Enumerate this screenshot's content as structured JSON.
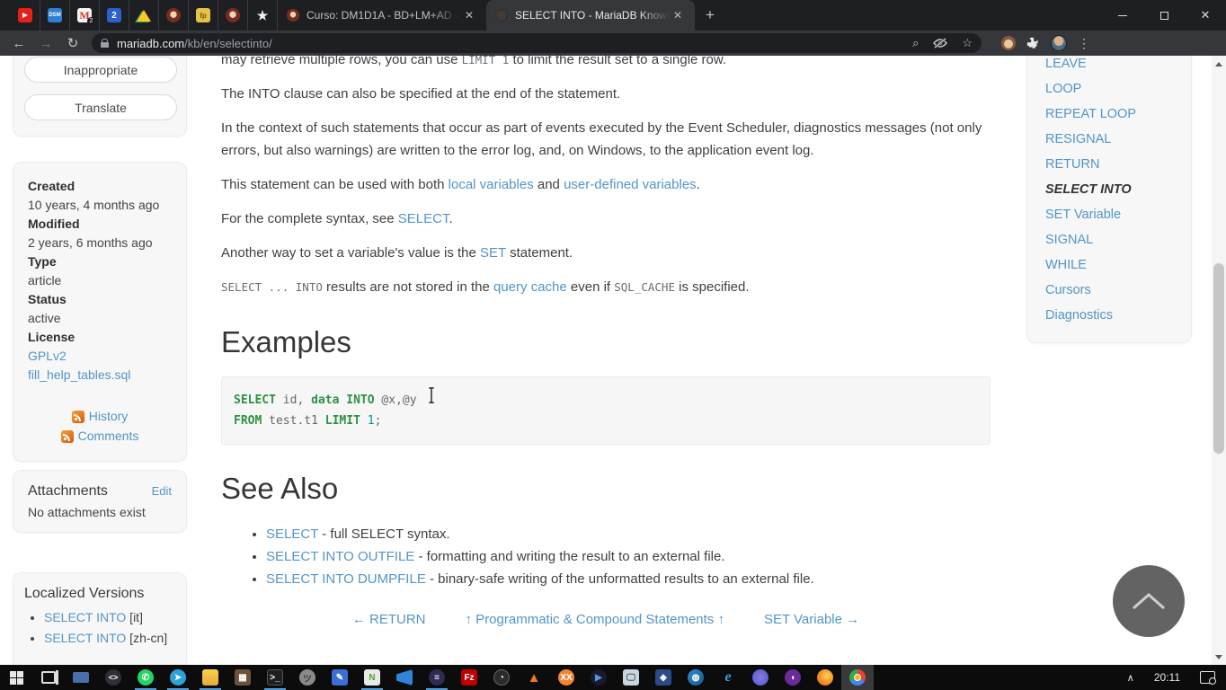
{
  "browser": {
    "pinned_favicons": [
      "youtube",
      "dsm",
      "gmail",
      "calendar-2",
      "google-drive",
      "moodle-crest",
      "fp-gold",
      "moodle-crest",
      "bookmark-star"
    ],
    "gmail_badge": "2",
    "calendar_glyph": "2",
    "dsm_label": "DSM",
    "fp_label": "fp",
    "star_glyph": "★",
    "tabs": [
      {
        "title": "Curso: DM1D1A - BD+LM+AD - ...",
        "close": "✕"
      },
      {
        "title": "SELECT INTO - MariaDB Knowled",
        "close": "✕"
      }
    ],
    "newtab_glyph": "+",
    "window_controls": {
      "close": "✕"
    },
    "nav": {
      "back": "←",
      "forward": "→",
      "reload": "↻"
    },
    "url": {
      "host": "mariadb.com",
      "path": "/kb/en/selectinto/"
    },
    "omnibox_icons": {
      "zoom": "⌕",
      "star": "☆",
      "dots": "⋮"
    }
  },
  "left_sidebar": {
    "flag_buttons": [
      "Inappropriate",
      "Translate"
    ],
    "info": {
      "rows": [
        {
          "label": "Created",
          "value": "10 years, 4 months ago"
        },
        {
          "label": "Modified",
          "value": "2 years, 6 months ago"
        },
        {
          "label": "Type",
          "value": "article"
        },
        {
          "label": "Status",
          "value": "active"
        },
        {
          "label": "License",
          "value": ""
        }
      ],
      "license_links": [
        "GPLv2",
        "fill_help_tables.sql"
      ],
      "feed_links": [
        "History",
        "Comments"
      ]
    },
    "attachments": {
      "title": "Attachments",
      "edit": "Edit",
      "body": "No attachments exist"
    },
    "localized": {
      "title": "Localized Versions",
      "items": [
        {
          "link": "SELECT INTO",
          "suffix": " [it]"
        },
        {
          "link": "SELECT INTO",
          "suffix": " [zh-cn]"
        }
      ]
    }
  },
  "content": {
    "p1": {
      "a": "may retrieve multiple rows, you can use ",
      "code": "LIMIT 1",
      "b": " to limit the result set to a single row."
    },
    "p2": "The INTO clause can also be specified at the end of the statement.",
    "p3": "In the context of such statements that occur as part of events executed by the Event Scheduler, diagnostics messages (not only errors, but also warnings) are written to the error log, and, on Windows, to the application event log.",
    "p4": {
      "a": "This statement can be used with both ",
      "link1": "local variables",
      "b": " and ",
      "link2": "user-defined variables",
      "c": "."
    },
    "p5": {
      "a": "For the complete syntax, see ",
      "link1": "SELECT",
      "b": "."
    },
    "p6": {
      "a": "Another way to set a variable's value is the ",
      "link1": "SET",
      "b": " statement."
    },
    "p7": {
      "code1": "SELECT ... INTO",
      "a": " results are not stored in the ",
      "link1": "query cache",
      "b": " even if ",
      "code2": "SQL_CACHE",
      "c": " is specified."
    },
    "examples_heading": "Examples",
    "code_example": {
      "tokens1": [
        "SELECT",
        " id, ",
        "data",
        " ",
        "INTO",
        " @x,@y"
      ],
      "tokens2": [
        "FROM",
        " test.t1 ",
        "LIMIT",
        " 1",
        ";"
      ]
    },
    "seealso_heading": "See Also",
    "seealso": [
      {
        "link": "SELECT",
        "text": " - full SELECT syntax."
      },
      {
        "link": "SELECT INTO OUTFILE",
        "text": " - formatting and writing the result to an external file."
      },
      {
        "link": "SELECT INTO DUMPFILE",
        "text": " - binary-safe writing of the unformatted results to an external file."
      }
    ],
    "bottom_nav": [
      "← RETURN",
      "↑ Programmatic & Compound Statements ↑",
      "SET Variable →"
    ]
  },
  "right_nav": {
    "items": [
      "LEAVE",
      "LOOP",
      "REPEAT LOOP",
      "RESIGNAL",
      "RETURN",
      "SELECT INTO",
      "SET Variable",
      "SIGNAL",
      "WHILE",
      "Cursors",
      "Diagnostics"
    ],
    "current": "SELECT INTO"
  },
  "taskbar": {
    "icons": [
      "start",
      "task-view",
      "touch-keyboard",
      "dev-app",
      "whatsapp",
      "telegram",
      "file-explorer",
      "library-app",
      "terminal",
      "gimp",
      "editor-app",
      "notepad-plus-plus",
      "vscode",
      "eclipse",
      "filezilla",
      "obs",
      "vlc",
      "xampp",
      "media-player",
      "screen-app",
      "virtualbox",
      "globe-app",
      "internet-explorer",
      "browser-app",
      "audio-app",
      "firefox",
      "chrome"
    ],
    "running": [
      "whatsapp",
      "telegram",
      "file-explorer",
      "terminal",
      "notepad-plus-plus",
      "eclipse"
    ],
    "active": "chrome",
    "tray": {
      "chevron": "∧",
      "time": "20:11"
    }
  },
  "colors": {
    "link": "#5295c7",
    "keyword_green": "#2e9140",
    "number_teal": "#0f8b99",
    "accent_running": "#4f9bd8"
  }
}
